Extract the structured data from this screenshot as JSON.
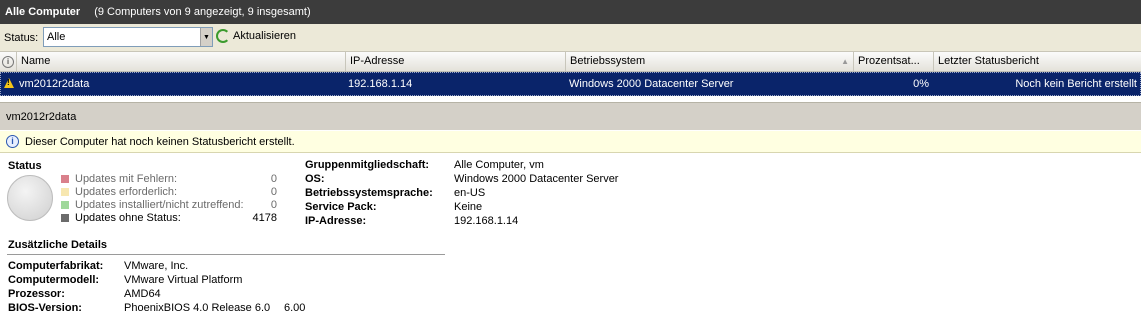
{
  "titlebar": {
    "title": "Alle Computer",
    "subtitle": "(9 Computers von 9 angezeigt, 9 insgesamt)"
  },
  "toolbar": {
    "status_label": "Status:",
    "status_value": "Alle",
    "refresh_label": "Aktualisieren"
  },
  "grid": {
    "columns": [
      "Name",
      "IP-Adresse",
      "Betriebssystem",
      "Prozentsat...",
      "Letzter Statusbericht"
    ],
    "selected_row": {
      "name": "vm2012r2data",
      "ip": "192.168.1.14",
      "os": "Windows 2000 Datacenter Server",
      "percent": "0%",
      "last_report": "Noch kein Bericht erstellt"
    }
  },
  "details": {
    "title": "vm2012r2data",
    "info_message": "Dieser Computer hat noch keinen Statusbericht erstellt.",
    "status": {
      "heading": "Status",
      "legend": [
        {
          "label": "Updates mit Fehlern:",
          "count": "0",
          "color": "#d9808b"
        },
        {
          "label": "Updates erforderlich:",
          "count": "0",
          "color": "#f7e7b0"
        },
        {
          "label": "Updates installiert/nicht zutreffend:",
          "count": "0",
          "color": "#9fd89a"
        },
        {
          "label": "Updates ohne Status:",
          "count": "4178",
          "color": "#6b6b6b"
        }
      ]
    },
    "group": {
      "membership_label": "Gruppenmitgliedschaft:",
      "membership_value": "Alle Computer, vm",
      "os_label": "OS:",
      "os_value": "Windows 2000 Datacenter Server",
      "lang_label": "Betriebssystemsprache:",
      "lang_value": "en-US",
      "sp_label": "Service Pack:",
      "sp_value": "Keine",
      "ip_label": "IP-Adresse:",
      "ip_value": "192.168.1.14"
    },
    "additional": {
      "heading": "Zusätzliche Details",
      "maker_label": "Computerfabrikat:",
      "maker_value": "VMware, Inc.",
      "model_label": "Computermodell:",
      "model_value": "VMware Virtual Platform",
      "cpu_label": "Prozessor:",
      "cpu_value": "AMD64",
      "bios_label": "BIOS-Version:",
      "bios_value": "PhoenixBIOS 4.0 Release 6.0",
      "bios_value2": "6.00"
    }
  },
  "colors": {
    "selection": "#0a246a",
    "infobar": "#ffffe1",
    "titlebar": "#3c3c3c"
  },
  "icons": [
    "info-icon",
    "warning-icon",
    "refresh-icon",
    "chevron-down-icon",
    "sort-arrow-icon"
  ]
}
